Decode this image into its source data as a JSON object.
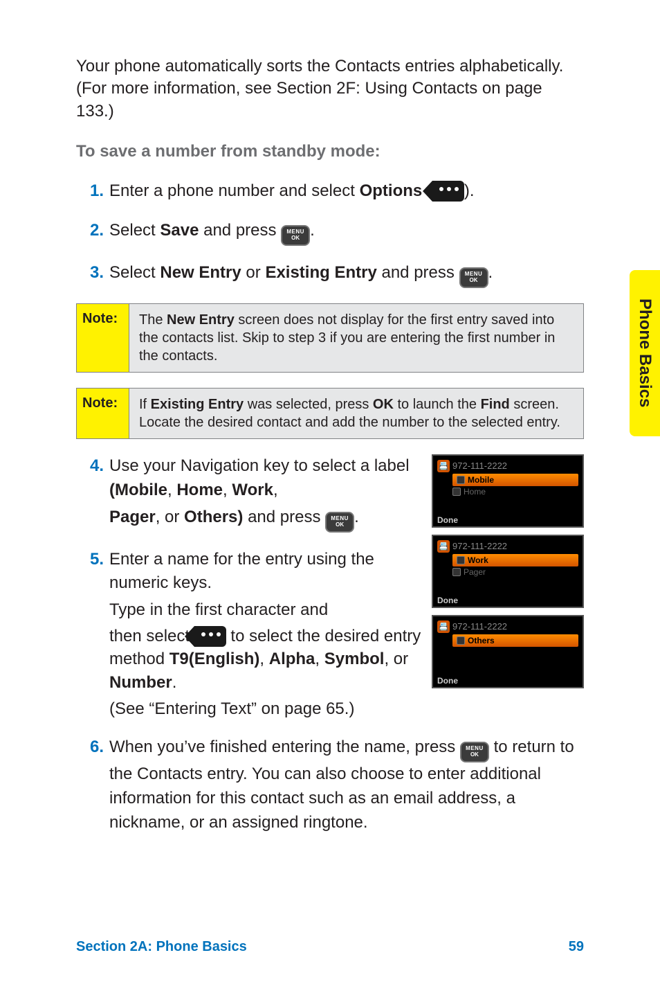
{
  "intro": "Your phone automatically sorts the Contacts entries alphabetically. (For more information, see Section 2F: Using Contacts on page 133.)",
  "subhead": "To save a number from standby mode:",
  "steps": {
    "s1": {
      "num": "1.",
      "pre": "Enter a phone number and select ",
      "bold": "Options",
      "post": " (",
      "tail": ")."
    },
    "s2": {
      "num": "2.",
      "pre": "Select ",
      "bold": "Save",
      "post": " and press ",
      "tail": "."
    },
    "s3": {
      "num": "3.",
      "pre": "Select ",
      "bold1": "New Entry",
      "mid": " or ",
      "bold2": "Existing Entry",
      "post": " and press ",
      "tail": "."
    },
    "s4": {
      "num": "4.",
      "line1a": "Use your Navigation key to select a label ",
      "line1b": "(Mobile",
      "line1c": ", ",
      "line1d": "Home",
      "line1e": ", ",
      "line1f": "Work",
      "line1g": ", ",
      "line2a": "Pager",
      "line2b": ", or ",
      "line2c": "Others)",
      "line2d": " and press ",
      "line2e": "."
    },
    "s5": {
      "num": "5.",
      "l1": "Enter a name for the entry using the numeric keys.",
      "l2": "Type in the first character and ",
      "l3a": "then select ",
      "l3b": " to select the desired entry method ",
      "l3c": "T9(English)",
      "l3d": ", ",
      "l3e": "Alpha",
      "l3f": ", ",
      "l3g": "Symbol",
      "l3h": ", or ",
      "l3i": "Number",
      "l3j": ".",
      "l4": "(See “Entering Text” on page 65.)"
    },
    "s6": {
      "num": "6.",
      "a": "When you’ve finished entering the name, press ",
      "b": " to return to the Contacts entry. You can also choose to enter additional information for this contact such as an email address, a nickname, or an assigned ringtone."
    }
  },
  "key": {
    "menu": "MENU",
    "ok": "OK"
  },
  "note1": {
    "label": "Note:",
    "pre": "The ",
    "bold": "New Entry",
    "post": " screen does not display for the first entry saved into the contacts list. Skip to step 3 if you are entering the first number in the contacts."
  },
  "note2": {
    "label": "Note:",
    "pre": "If ",
    "b1": "Existing Entry",
    "mid1": " was selected, press ",
    "b2": "OK",
    "mid2": " to launch the ",
    "b3": "Find",
    "post": " screen. Locate the desired contact and add the number to the selected entry."
  },
  "shots": {
    "number": "972-111-2222",
    "mobile": "Mobile",
    "home": "Home",
    "work": "Work",
    "pager": "Pager",
    "others": "Others",
    "done": "Done"
  },
  "sidetab": "Phone Basics",
  "footer": {
    "section": "Section 2A: Phone Basics",
    "page": "59"
  }
}
